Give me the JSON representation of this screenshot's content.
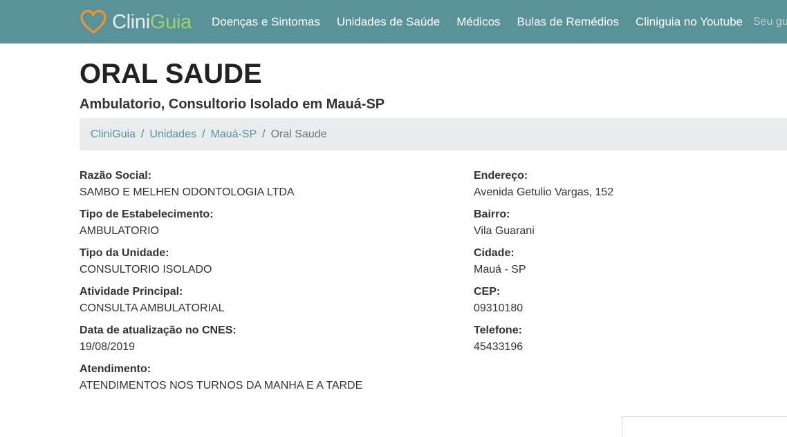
{
  "header": {
    "brand_primary": "Clini",
    "brand_secondary": "Guia",
    "logo_icon": "heart-outline-icon",
    "nav_items": [
      {
        "label": "Doenças e Sintomas"
      },
      {
        "label": "Unidades de Saúde"
      },
      {
        "label": "Médicos"
      },
      {
        "label": "Bulas de Remédios"
      },
      {
        "label": "Cliniguia no Youtube"
      }
    ],
    "search_placeholder": "Seu guia",
    "colors": {
      "navbar_bg": "#5a9299",
      "brand_orange": "#f0942e",
      "brand_green": "#9fd36a"
    }
  },
  "main": {
    "title": "ORAL SAUDE",
    "subtitle": "Ambulatorio, Consultorio Isolado em Mauá-SP",
    "breadcrumb": [
      {
        "label": "CliniGuia"
      },
      {
        "label": "Unidades"
      },
      {
        "label": "Mauá-SP"
      },
      {
        "label": "Oral Saude"
      }
    ],
    "left_fields": [
      {
        "label": "Razão Social:",
        "value": "SAMBO E MELHEN ODONTOLOGIA LTDA"
      },
      {
        "label": "Tipo de Estabelecimento:",
        "value": "AMBULATORIO"
      },
      {
        "label": "Tipo da Unidade:",
        "value": "CONSULTORIO ISOLADO"
      },
      {
        "label": "Atividade Principal:",
        "value": "CONSULTA AMBULATORIAL"
      },
      {
        "label": "Data de atualização no CNES:",
        "value": "19/08/2019"
      },
      {
        "label": "Atendimento:",
        "value": "ATENDIMENTOS NOS TURNOS DA MANHA E A TARDE"
      }
    ],
    "right_fields": [
      {
        "label": "Endereço:",
        "value": "Avenida Getulio Vargas, 152"
      },
      {
        "label": "Bairro:",
        "value": "Vila Guarani"
      },
      {
        "label": "Cidade:",
        "value": "Mauá - SP"
      },
      {
        "label": "CEP:",
        "value": "09310180"
      },
      {
        "label": "Telefone:",
        "value": "45433196"
      }
    ]
  }
}
